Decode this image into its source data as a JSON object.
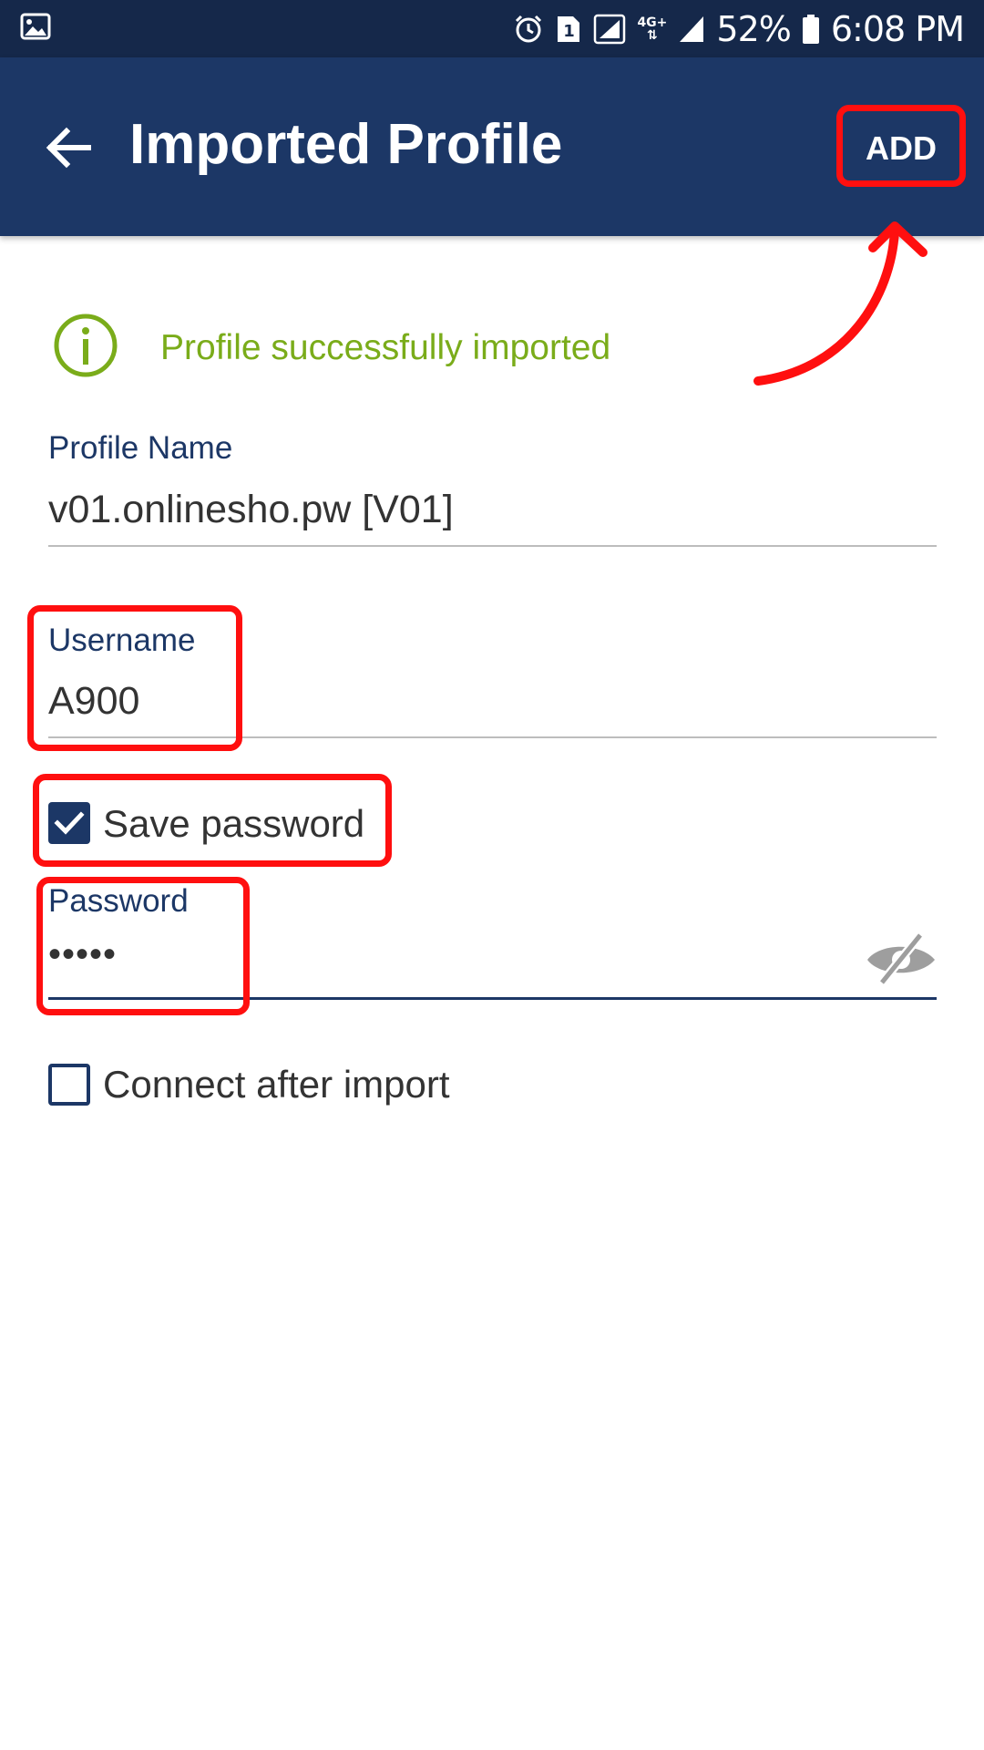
{
  "status_bar": {
    "battery": "52%",
    "time": "6:08 PM",
    "sim_slot": "1",
    "network_type": "4G+",
    "icons": [
      "gallery-icon",
      "alarm-icon",
      "sim-slot-icon",
      "signal-icon",
      "network-4g-icon",
      "signal-icon",
      "battery-icon"
    ]
  },
  "app_bar": {
    "title": "Imported Profile",
    "back_icon": "arrow-left-icon",
    "add_label": "ADD"
  },
  "message": {
    "icon": "info-icon",
    "text": "Profile successfully imported",
    "color": "#7aac1a"
  },
  "form": {
    "profile_name": {
      "label": "Profile Name",
      "value": "v01.onlinesho.pw [V01]"
    },
    "username": {
      "label": "Username",
      "value": "A900"
    },
    "save_password": {
      "label": "Save password",
      "checked": true
    },
    "password": {
      "label": "Password",
      "value": "•••••",
      "visibility_icon": "eye-off-icon"
    },
    "connect_after_import": {
      "label": "Connect after import",
      "checked": false
    }
  },
  "annotations": {
    "callout_color": "#ff0f0f",
    "targets": [
      "add-button",
      "username-field",
      "save-password-checkbox",
      "password-field"
    ]
  },
  "colors": {
    "status_bar": "#15284a",
    "app_bar": "#1c3766",
    "accent": "#1c3766",
    "success": "#7aac1a"
  }
}
